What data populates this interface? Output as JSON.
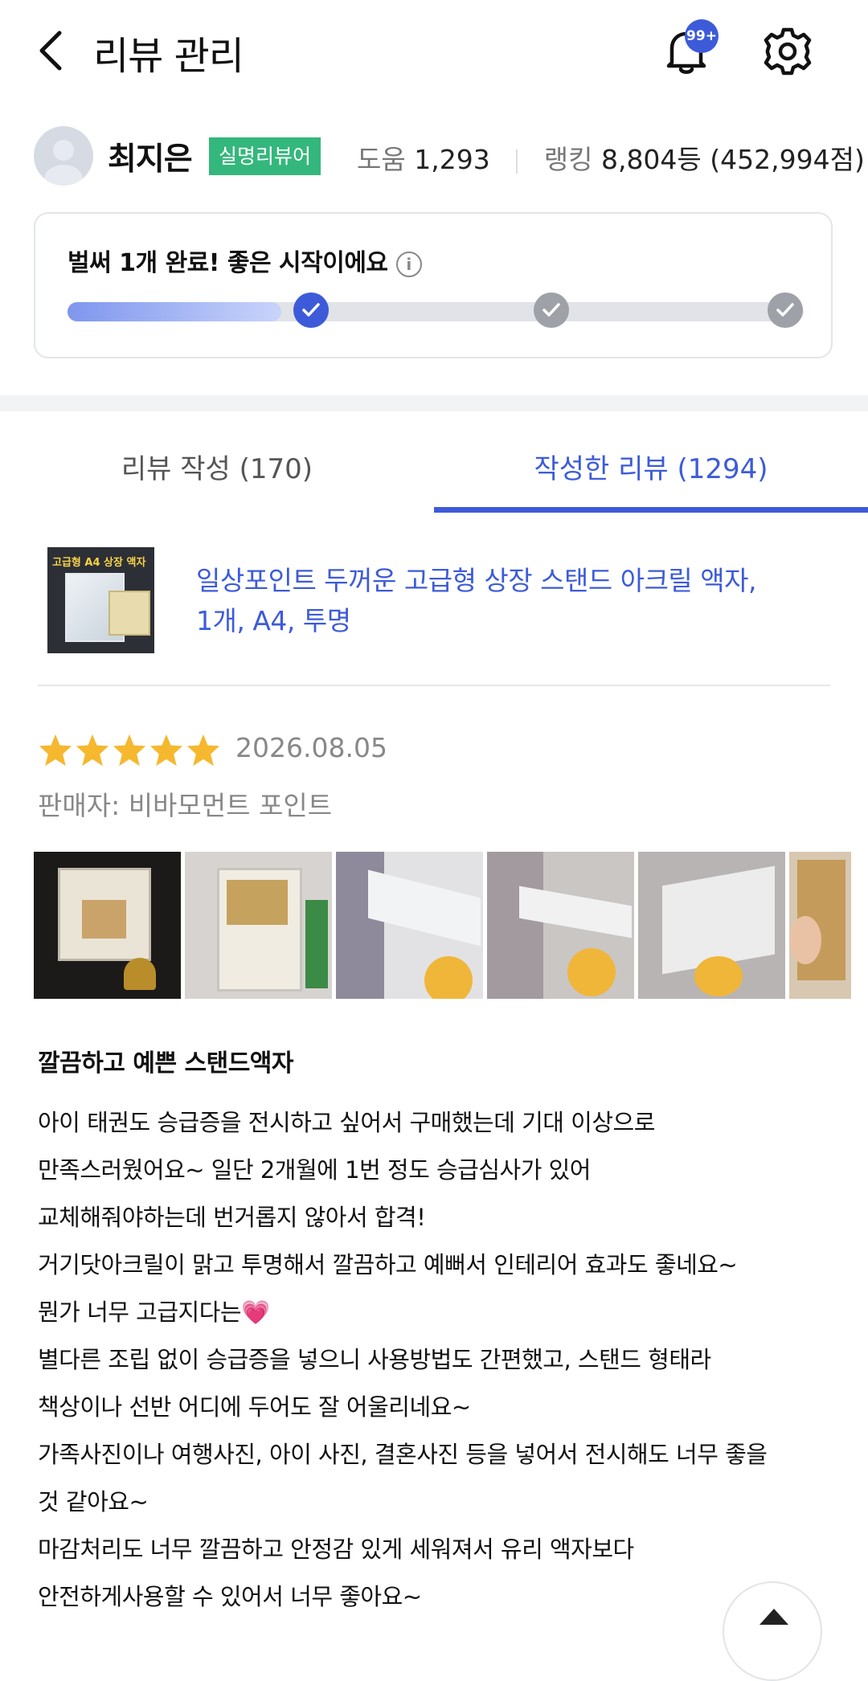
{
  "header": {
    "title": "리뷰 관리",
    "notification_badge": "99+"
  },
  "profile": {
    "name": "최지은",
    "badge": "실명리뷰어",
    "help_label": "도움",
    "help_count": "1,293",
    "ranking_label": "랭킹",
    "ranking_value": "8,804등 (452,994점)"
  },
  "progress": {
    "message": "벌써 1개 완료! 좋은 시작이에요",
    "completed_steps": 1,
    "total_steps": 3,
    "fill_fraction": 0.29
  },
  "tabs": [
    {
      "label": "리뷰 작성 (170)",
      "active": false
    },
    {
      "label": "작성한 리뷰 (1294)",
      "active": true
    }
  ],
  "product": {
    "thumb_text": "고급형 A4 상장 액자",
    "name_line1": "일상포인트 두꺼운 고급형 상장 스탠드 아크릴 액자,",
    "name_line2": "1개, A4, 투명"
  },
  "review": {
    "rating": 5,
    "date": "2026.08.05",
    "seller": "판매자: 비바모먼트 포인트",
    "photo_count_visible": 6,
    "title": "깔끔하고 예쁜 스탠드액자",
    "lines": [
      "아이 태권도 승급증을 전시하고 싶어서 구매했는데 기대 이상으로",
      "만족스러웠어요~ 일단 2개월에 1번 정도 승급심사가 있어",
      "교체해줘야하는데 번거롭지 않아서 합격!",
      "거기닷아크릴이 맑고 투명해서 깔끔하고 예뻐서 인테리어 효과도 좋네요~",
      "뭔가 너무 고급지다는💗",
      "별다른 조립 없이 승급증을 넣으니 사용방법도 간편했고, 스탠드 형태라",
      "책상이나 선반 어디에 두어도 잘 어울리네요~",
      "가족사진이나 여행사진, 아이 사진, 결혼사진 등을 넣어서 전시해도 너무 좋을",
      "것 같아요~",
      "마감처리도 너무 깔끔하고 안정감 있게 세워져서 유리 액자보다",
      "안전하게사용할 수 있어서 너무 좋아요~"
    ]
  },
  "colors": {
    "accent": "#3d5bd9",
    "badge_green": "#34b77c",
    "star": "#f5b82e"
  }
}
